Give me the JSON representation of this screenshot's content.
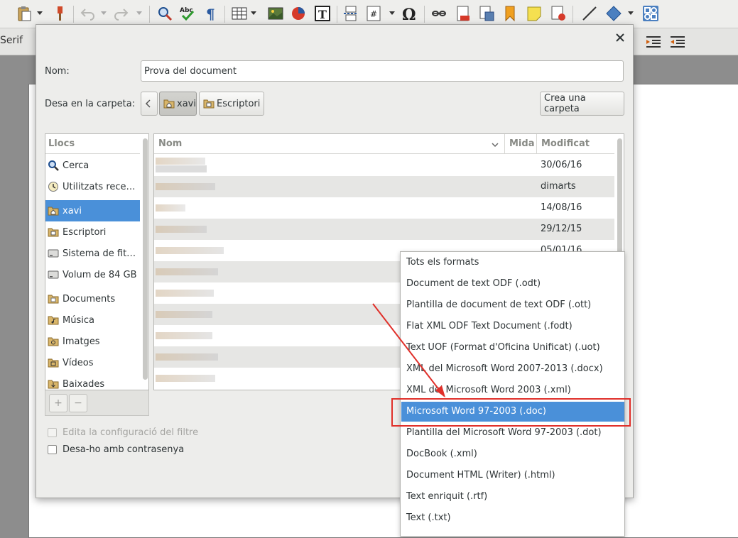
{
  "toolbar2": {
    "font_name": "Serif"
  },
  "dialog": {
    "name_label": "Nom:",
    "name_value": "Prova del document",
    "folder_label": "Desa en la carpeta:",
    "path": [
      {
        "label": "xavi",
        "icon": "home-folder-icon",
        "active": true
      },
      {
        "label": "Escriptori",
        "icon": "desktop-folder-icon",
        "active": false
      }
    ],
    "create_folder_button": "Crea una carpeta",
    "places_header": "Llocs",
    "places": [
      {
        "label": "Cerca",
        "icon": "search-icon"
      },
      {
        "label": "Utilitzats rece…",
        "icon": "recent-icon"
      },
      {
        "label": "xavi",
        "icon": "home-folder-icon",
        "selected": true
      },
      {
        "label": "Escriptori",
        "icon": "desktop-folder-icon"
      },
      {
        "label": "Sistema de fit…",
        "icon": "drive-icon"
      },
      {
        "label": "Volum de 84 GB",
        "icon": "drive-icon"
      },
      {
        "label": "Documents",
        "icon": "documents-folder-icon"
      },
      {
        "label": "Música",
        "icon": "music-folder-icon"
      },
      {
        "label": "Imatges",
        "icon": "pictures-folder-icon"
      },
      {
        "label": "Vídeos",
        "icon": "videos-folder-icon"
      },
      {
        "label": "Baixades",
        "icon": "downloads-folder-icon"
      }
    ],
    "places_add": "+",
    "places_remove": "−",
    "columns": {
      "name": "Nom",
      "size": "Mida",
      "modified": "Modificat"
    },
    "files": [
      {
        "modified": "30/06/16"
      },
      {
        "modified": "dimarts"
      },
      {
        "modified": "14/08/16"
      },
      {
        "modified": "29/12/15"
      },
      {
        "modified": "05/01/16"
      }
    ],
    "edit_filter_label": "Edita la configuració del filtre",
    "password_label": "Desa-ho amb contrasenya"
  },
  "format_menu": {
    "items": [
      "Tots els formats",
      "Document de text ODF (.odt)",
      "Plantilla de document de text ODF (.ott)",
      "Flat XML ODF Text Document (.fodt)",
      "Text UOF (Format d'Oficina Unificat) (.uot)",
      "XML del Microsoft Word 2007-2013 (.docx)",
      "XML del Microsoft Word 2003 (.xml)",
      "Microsoft Word 97-2003 (.doc)",
      "Plantilla del Microsoft Word 97-2003 (.dot)",
      "DocBook (.xml)",
      "Document HTML (Writer) (.html)",
      "Text enriquit (.rtf)",
      "Text (.txt)"
    ],
    "selected_index": 7
  },
  "colors": {
    "selection": "#4a90d9",
    "annotation": "#e0302a"
  }
}
